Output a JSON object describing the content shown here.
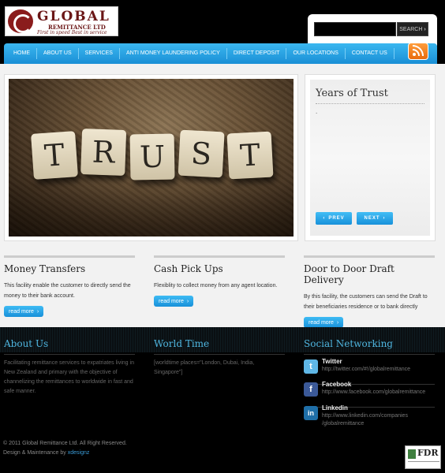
{
  "logo": {
    "name": "GLOBAL",
    "sub": "REMITTANCE LTD",
    "tagline": "First in speed Best in service"
  },
  "search": {
    "value": "",
    "button": "SEARCH"
  },
  "nav": {
    "items": [
      "HOME",
      "ABOUT US",
      "SERVICES",
      "ANTI MONEY LAUNDERING POLICY",
      "DIRECT DEPOSIT",
      "OUR LOCATIONS",
      "CONTACT US"
    ]
  },
  "slider": {
    "tiles": [
      "T",
      "R",
      "U",
      "S",
      "T"
    ]
  },
  "trust": {
    "title": "Years of Trust",
    "body": ".",
    "prev": "PREV",
    "next": "NEXT"
  },
  "services": [
    {
      "title": "Money Transfers",
      "text": "This facility enable the customer to directly send the money to their bank account.",
      "button": "read more"
    },
    {
      "title": "Cash Pick Ups",
      "text": "Flexiblity to collect money from any agent location.",
      "button": "read more"
    },
    {
      "title": "Door to Door Draft Delivery",
      "text": "By this facility, the customers can send the Draft to their beneficiaries residence or to bank directly",
      "button": "read more"
    }
  ],
  "footer": {
    "about": {
      "title": "About Us",
      "text": "Facilitating remittance services to expatriates living in New Zealand and primary with the objective of channelizing the remittances to worldwide in fast and safe manner."
    },
    "world_time": {
      "title": "World Time",
      "text": "[worldtime places=\"London, Dubai, India, Singapore\"]"
    },
    "social": {
      "title": "Social Networking",
      "items": [
        {
          "name": "Twitter",
          "url": "http://twitter.com/#!/globalremittance",
          "icon": "twitter-icon",
          "color": "#5fb7e6"
        },
        {
          "name": "Facebook",
          "url": "http://www.facebook.com/globalremittance",
          "icon": "facebook-icon",
          "color": "#3b5998"
        },
        {
          "name": "Linkedin",
          "url": "http://www.linkedin.com/companies /globalremittance",
          "icon": "linkedin-icon",
          "color": "#1f6fa8"
        }
      ]
    },
    "copyright": "© 2011 Global Remittance Ltd. All Right Reserved.",
    "design_label": "Design & Maintenance by",
    "design_link": "xdesignz",
    "badge": "FDR"
  },
  "colors": {
    "accent": "#1a9ae0",
    "nav_top": "#3bb7f0",
    "heading_footer": "#4fb6e0",
    "rss": "#f07a1a"
  }
}
